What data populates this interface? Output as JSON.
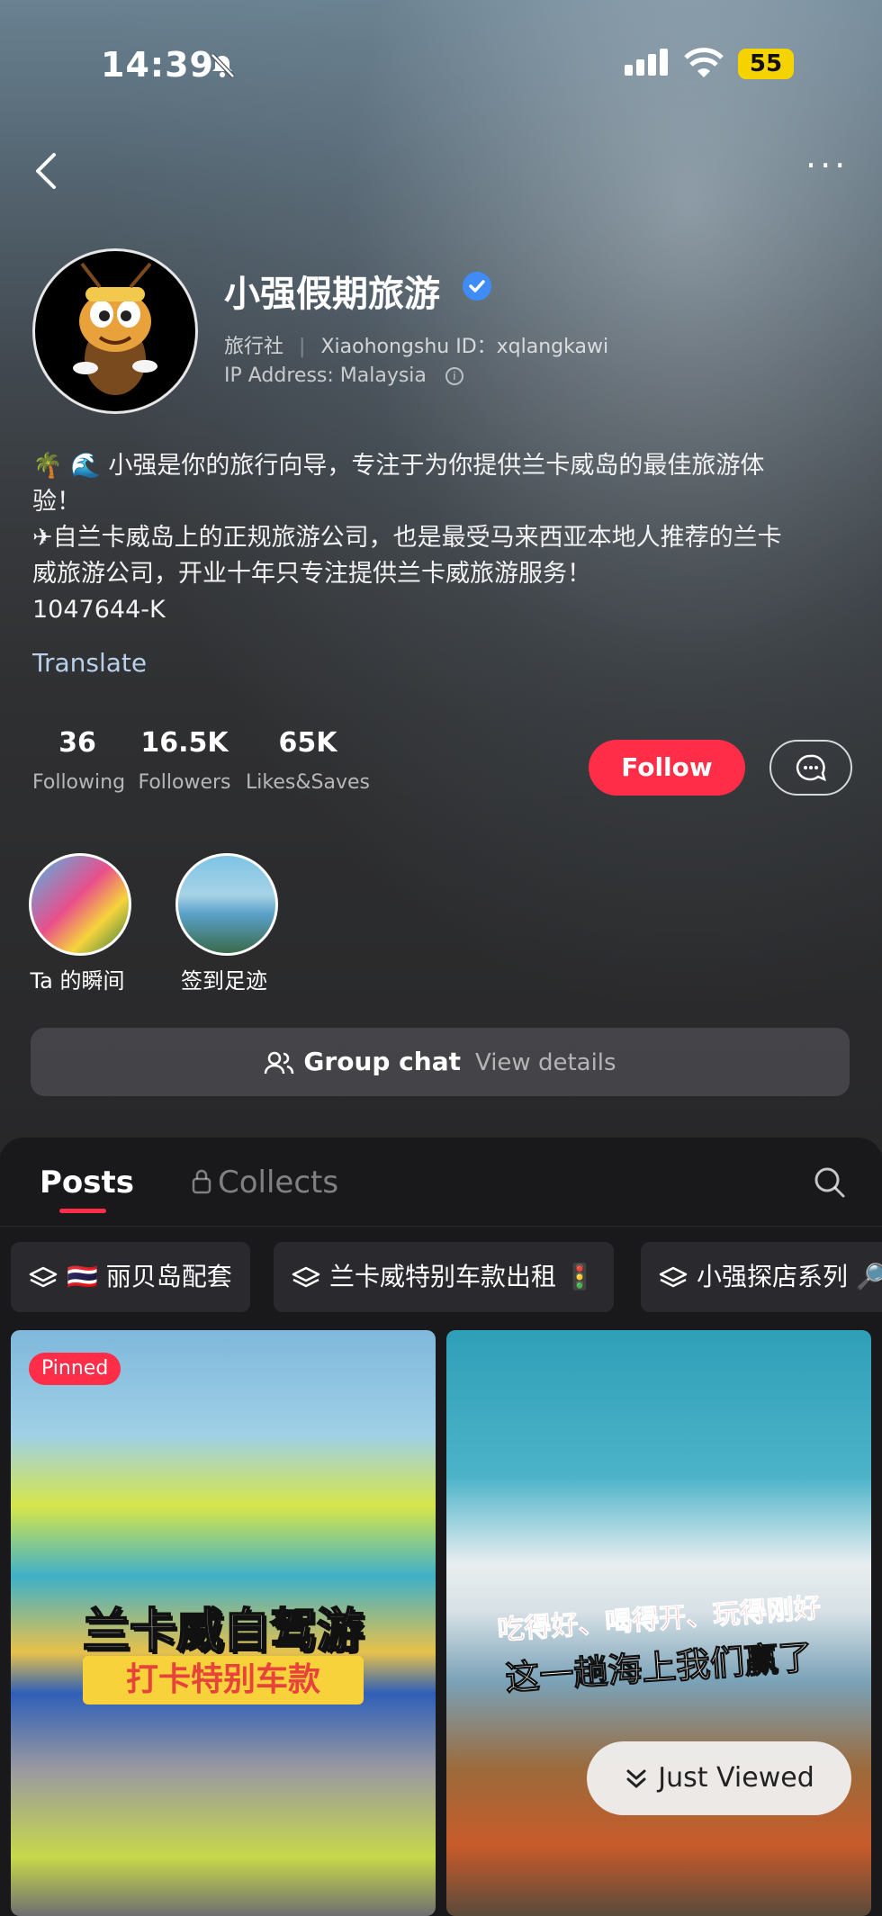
{
  "status": {
    "time": "14:39",
    "battery": "55"
  },
  "profile": {
    "name": "小强假期旅游",
    "category": "旅行社",
    "id_label": "Xiaohongshu ID：xqlangkawi",
    "ip": "IP Address: Malaysia",
    "bio_lines": [
      "🌴 🌊 小强是你的旅行向导，专注于为你提供兰卡威岛的最佳旅游体",
      "验！",
      "✈自兰卡威岛上的正规旅游公司，也是最受马来西亚本地人推荐的兰卡",
      "威旅游公司，开业十年只专注提供兰卡威旅游服务！",
      "1047644-K"
    ],
    "translate": "Translate"
  },
  "stats": [
    {
      "num": "36",
      "label": "Following"
    },
    {
      "num": "16.5K",
      "label": "Followers"
    },
    {
      "num": "65K",
      "label": "Likes&Saves"
    }
  ],
  "actions": {
    "follow": "Follow"
  },
  "highlights": [
    {
      "label": "Ta 的瞬间"
    },
    {
      "label": "签到足迹"
    }
  ],
  "group_chat": {
    "title": "Group chat",
    "detail": "View details"
  },
  "tabs": {
    "posts": "Posts",
    "collects": "Collects"
  },
  "chips": [
    "🇹🇭 丽贝岛配套",
    "兰卡威特别车款出租 🚦",
    "小强探店系列 🔎"
  ],
  "cards": [
    {
      "badge": "Pinned",
      "headline1": "兰卡威自驾游",
      "headline2": "打卡特别车款"
    },
    {
      "headline1": "吃得好、喝得开、玩得刚好",
      "headline2": "这一趟海上我们赢了"
    }
  ],
  "just_viewed": "Just Viewed",
  "colors": {
    "accent": "#ff2d48",
    "verified": "#3f8cf7",
    "battery": "#f5d300"
  }
}
